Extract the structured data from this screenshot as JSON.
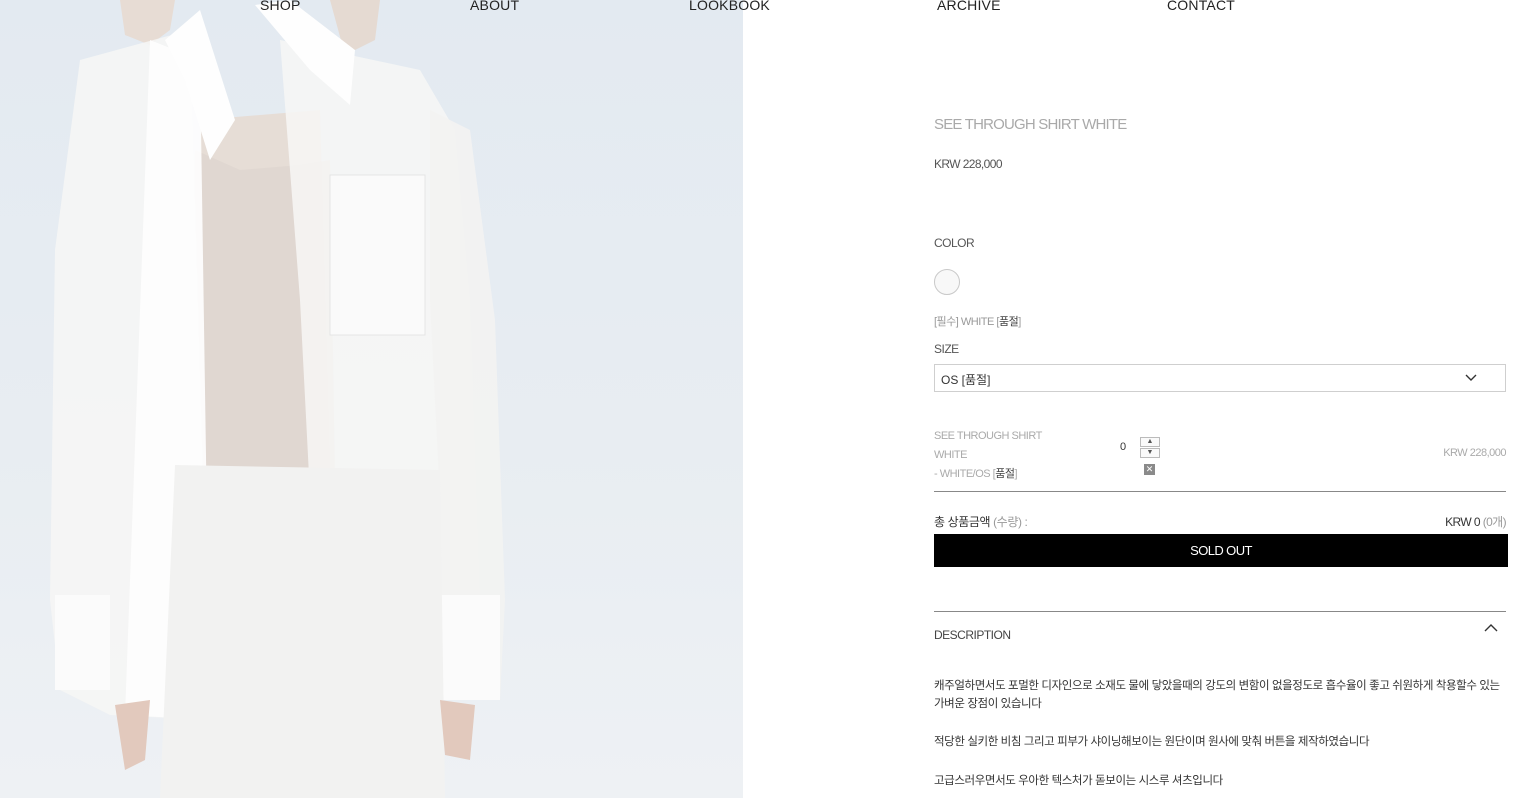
{
  "nav": {
    "items": [
      {
        "label": "SHOP"
      },
      {
        "label": "ABOUT"
      },
      {
        "label": "LOOKBOOK"
      },
      {
        "label": "ARCHIVE"
      },
      {
        "label": "CONTACT"
      }
    ]
  },
  "product": {
    "title": "SEE THROUGH SHIRT WHITE",
    "price": "KRW 228,000",
    "color_label": "COLOR",
    "color_swatch": "#f8f8f8",
    "option_note": {
      "prefix": "[필수] WHITE [",
      "status": "품절",
      "suffix": "]"
    },
    "size_label": "SIZE",
    "size_select": "OS [품절]"
  },
  "selected_line": {
    "name_line1": "SEE THROUGH SHIRT",
    "name_line2": "WHITE",
    "option_prefix": "- WHITE/OS [",
    "option_status": "품절",
    "option_suffix": "]",
    "quantity": "0",
    "price": "KRW 228,000"
  },
  "total": {
    "label": "총 상품금액",
    "label_suffix": "(수량) :",
    "value": "KRW 0",
    "count": "(0개)"
  },
  "buttons": {
    "sold_out": "SOLD OUT"
  },
  "description": {
    "heading": "DESCRIPTION",
    "paragraphs": [
      "캐주얼하면서도 포멀한 디자인으로 소재도 물에 닿았을때의 강도의 변함이 없을정도로 흡수율이 좋고 쉬원하게 착용할수 있는 가벼운 장점이 있습니다",
      "적당한 실키한 비침 그리고 피부가 샤이닝해보이는 원단이며 원사에 맞춰 버튼을 제작하였습니다",
      "고급스러우면서도 우아한 텍스처가 돋보이는 시스루 셔츠입니다"
    ]
  },
  "colors": {
    "accent": "#000000",
    "muted": "#aaaaaa"
  }
}
